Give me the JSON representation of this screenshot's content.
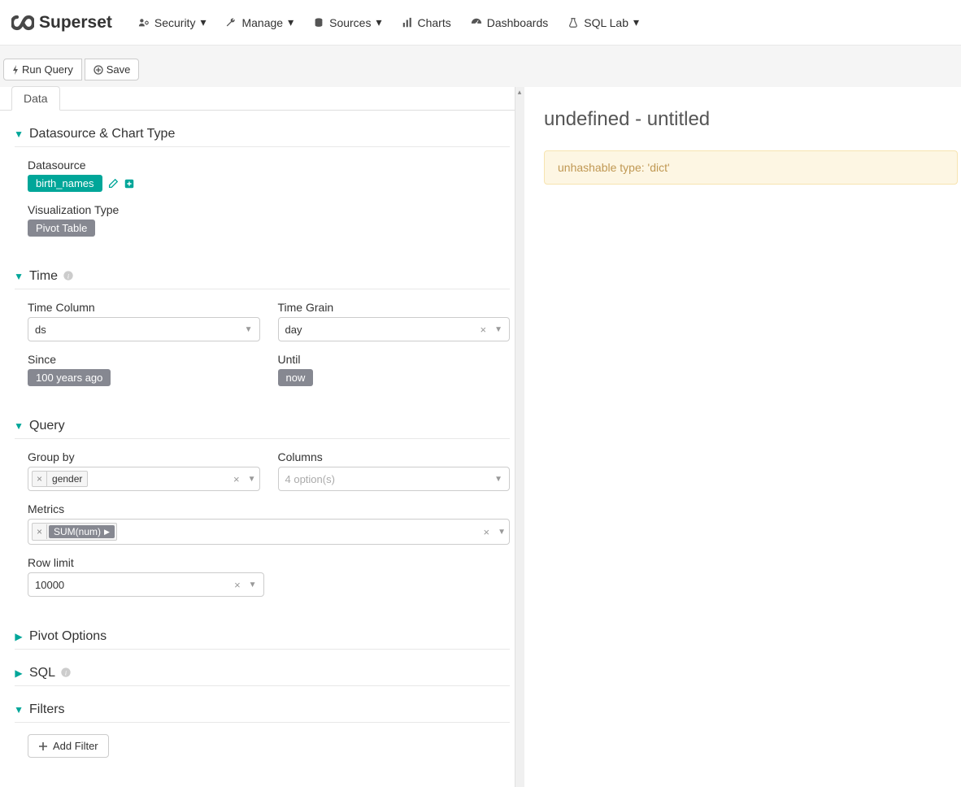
{
  "brand": "Superset",
  "nav": {
    "security": "Security",
    "manage": "Manage",
    "sources": "Sources",
    "charts": "Charts",
    "dashboards": "Dashboards",
    "sqllab": "SQL Lab"
  },
  "toolbar": {
    "run": "Run Query",
    "save": "Save"
  },
  "tabs": {
    "data": "Data"
  },
  "sections": {
    "datasource": {
      "title": "Datasource & Chart Type",
      "datasource_label": "Datasource",
      "datasource_value": "birth_names",
      "viz_label": "Visualization Type",
      "viz_value": "Pivot Table"
    },
    "time": {
      "title": "Time",
      "time_column_label": "Time Column",
      "time_column_value": "ds",
      "time_grain_label": "Time Grain",
      "time_grain_value": "day",
      "since_label": "Since",
      "since_value": "100 years ago",
      "until_label": "Until",
      "until_value": "now"
    },
    "query": {
      "title": "Query",
      "groupby_label": "Group by",
      "groupby_value": "gender",
      "columns_label": "Columns",
      "columns_placeholder": "4 option(s)",
      "metrics_label": "Metrics",
      "metrics_value": "SUM(num)",
      "rowlimit_label": "Row limit",
      "rowlimit_value": "10000"
    },
    "pivot": {
      "title": "Pivot Options"
    },
    "sql": {
      "title": "SQL"
    },
    "filters": {
      "title": "Filters",
      "add": "Add Filter"
    }
  },
  "chart": {
    "title": "undefined - untitled",
    "error": "unhashable type: 'dict'"
  }
}
